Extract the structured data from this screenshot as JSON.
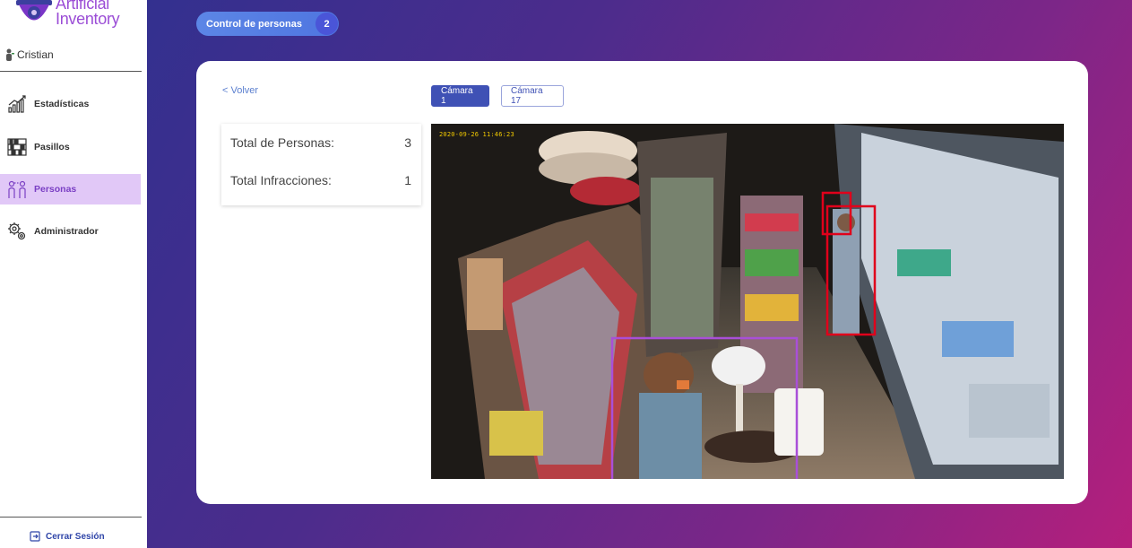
{
  "brand": {
    "line1": "Artificial",
    "line2": "Inventory"
  },
  "user": {
    "name": "Cristian"
  },
  "nav": {
    "items": [
      {
        "label": "Estadísticas",
        "icon": "chart-icon",
        "active": false
      },
      {
        "label": "Pasillos",
        "icon": "shelves-icon",
        "active": false
      },
      {
        "label": "Personas",
        "icon": "people-icon",
        "active": true
      },
      {
        "label": "Administrador",
        "icon": "gears-icon",
        "active": false
      }
    ],
    "logout": "Cerrar Sesión"
  },
  "header": {
    "title": "Control de personas",
    "count": "2"
  },
  "panel": {
    "back": "< Volver",
    "tabs": [
      {
        "label": "Cámara 1",
        "active": true
      },
      {
        "label": "Cámara 17",
        "active": false
      }
    ],
    "stats": [
      {
        "label": "Total de Personas:",
        "value": "3"
      },
      {
        "label": "Total Infracciones:",
        "value": "1"
      }
    ],
    "video": {
      "timestamp": "2020-09-26  11:46:23"
    }
  },
  "colors": {
    "accent": "#3f51b5",
    "brand": "#9b4dd6",
    "active_nav_bg": "#e1c8f7",
    "detection_violation": "#e0001b",
    "detection_ok": "#a94fd8"
  }
}
